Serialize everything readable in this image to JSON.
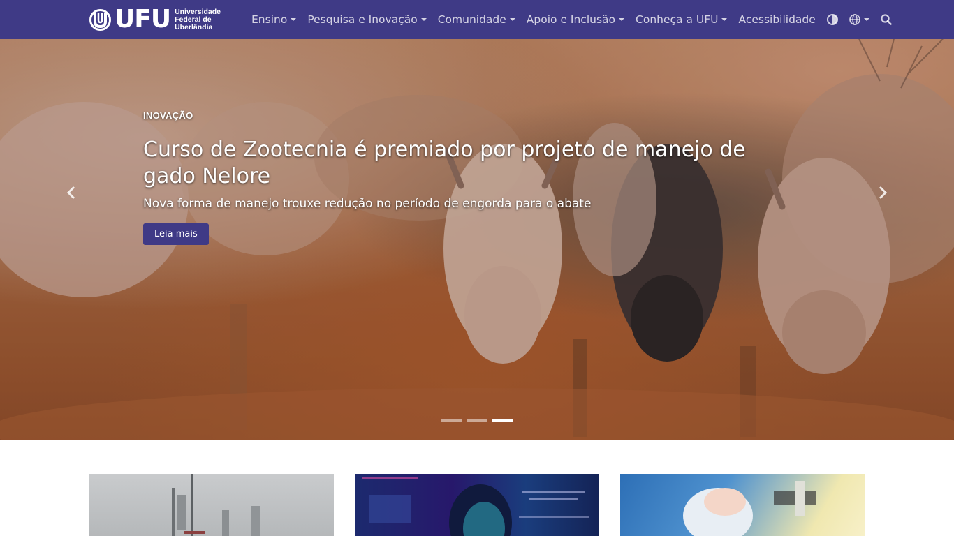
{
  "brand": {
    "mark_text": "UFU",
    "full_name": "Universidade Federal de Uberlândia"
  },
  "nav": {
    "items": [
      {
        "label": "Ensino",
        "dropdown": true
      },
      {
        "label": "Pesquisa e Inovação",
        "dropdown": true
      },
      {
        "label": "Comunidade",
        "dropdown": true
      },
      {
        "label": "Apoio e Inclusão",
        "dropdown": true
      },
      {
        "label": "Conheça a UFU",
        "dropdown": true
      },
      {
        "label": "Acessibilidade",
        "dropdown": false
      }
    ],
    "icons": [
      "contrast-icon",
      "globe-icon",
      "search-icon"
    ]
  },
  "hero": {
    "kicker": "INOVAÇÃO",
    "headline": "Curso de Zootecnia é premiado por projeto de manejo de gado Nelore",
    "subline": "Nova forma de manejo trouxe redução no período de engorda para o abate",
    "cta": "Leia mais",
    "slides_count": 3,
    "active_slide": 3
  },
  "colors": {
    "brand": "#3f3a86",
    "text_on_brand": "#ffffff"
  }
}
